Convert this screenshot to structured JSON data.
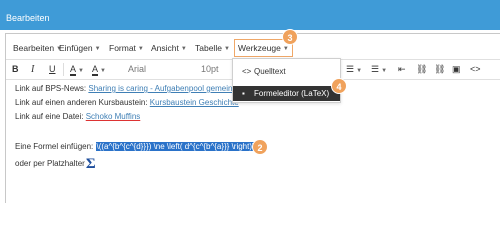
{
  "header": {
    "title": "Bearbeiten"
  },
  "menubar": {
    "items": [
      "Bearbeiten",
      "Einfügen",
      "Format",
      "Ansicht",
      "Tabelle",
      "Werkzeuge"
    ]
  },
  "toolbar": {
    "bold": "B",
    "italic": "I",
    "underline": "U",
    "text_color": "A",
    "font_family": "Arial",
    "font_size": "10pt"
  },
  "content": {
    "line1_prefix": "Link auf BPS-News: ",
    "line1_link": "Sharing is caring - Aufgabenpool gemeinsa",
    "line2_prefix": "Link auf einen anderen Kursbaustein: ",
    "line2_link": "Kursbaustein Geschichte",
    "line3_prefix": "Link auf eine Datei: ",
    "line3_link": "Schoko Muffins",
    "line4_prefix": "Eine Formel einfügen: ",
    "line4_formula": "\\((a^{b^{c^{d}}}) \\ne \\left( d^{c^{b^{a}}} \\right)\\)",
    "line5_prefix": "oder per Platzhalter",
    "sigma": "Σ"
  },
  "dropdown": {
    "items": [
      {
        "icon": "code-icon",
        "glyph": "<>",
        "label": "Quelltext"
      },
      {
        "icon": "formula-icon",
        "glyph": "▪",
        "label": "Formeleditor (LaTeX)"
      }
    ]
  },
  "badges": {
    "two": "2",
    "three": "3",
    "four": "4"
  },
  "colors": {
    "accent_orange": "#f0a25c",
    "header_blue": "#3f9bd7",
    "selection_blue": "#2a72c9",
    "link_blue": "#3f7fb5"
  }
}
